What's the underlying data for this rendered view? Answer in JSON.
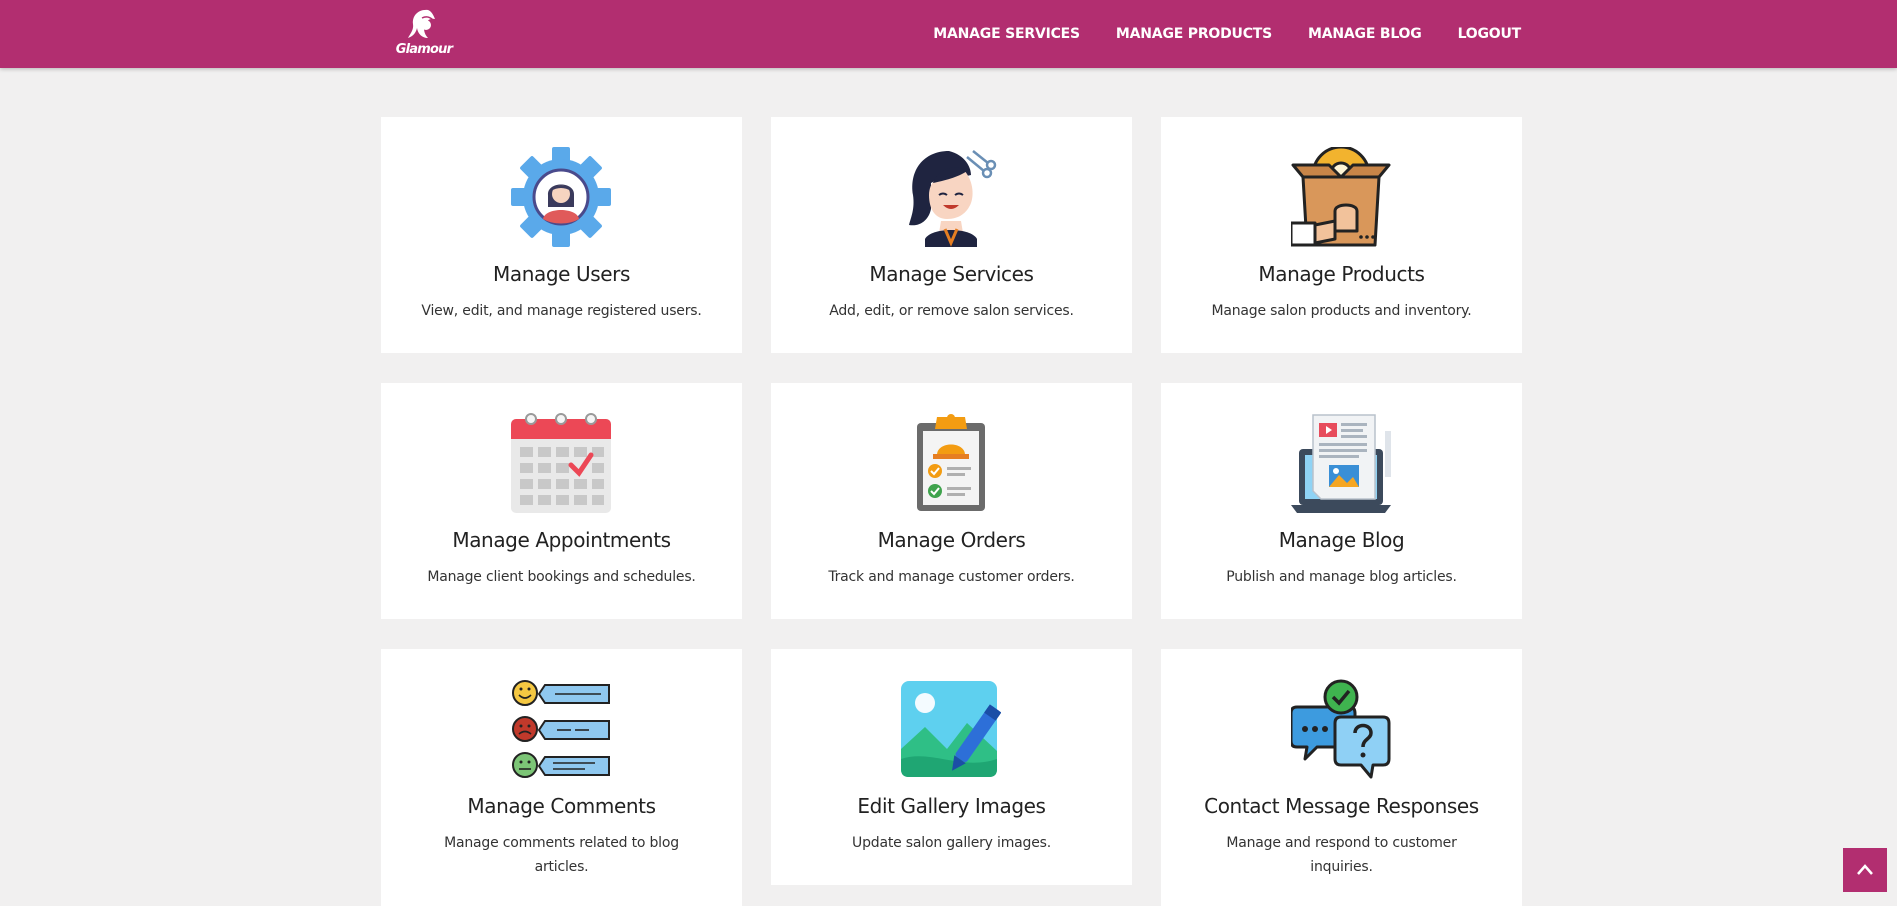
{
  "brand": {
    "logo_text": "Glamour",
    "primary_color": "#b22e70"
  },
  "nav": {
    "items": [
      {
        "label": "MANAGE SERVICES"
      },
      {
        "label": "MANAGE PRODUCTS"
      },
      {
        "label": "MANAGE BLOG"
      },
      {
        "label": "LOGOUT"
      }
    ]
  },
  "cards": [
    {
      "title": "Manage Users",
      "description": "View, edit, and manage registered users.",
      "icon": "user-gear-icon"
    },
    {
      "title": "Manage Services",
      "description": "Add, edit, or remove salon services.",
      "icon": "hair-salon-icon"
    },
    {
      "title": "Manage Products",
      "description": "Manage salon products and inventory.",
      "icon": "product-box-icon"
    },
    {
      "title": "Manage Appointments",
      "description": "Manage client bookings and schedules.",
      "icon": "calendar-icon"
    },
    {
      "title": "Manage Orders",
      "description": "Track and manage customer orders.",
      "icon": "clipboard-checklist-icon"
    },
    {
      "title": "Manage Blog",
      "description": "Publish and manage blog articles.",
      "icon": "laptop-blog-icon"
    },
    {
      "title": "Manage Comments",
      "description": "Manage comments related to blog articles.",
      "icon": "feedback-comments-icon"
    },
    {
      "title": "Edit Gallery Images",
      "description": "Update salon gallery images.",
      "icon": "image-edit-icon"
    },
    {
      "title": "Contact Message Responses",
      "description": "Manage and respond to customer inquiries.",
      "icon": "chat-bubbles-icon"
    }
  ],
  "scroll_top": {
    "icon": "chevron-up-icon"
  }
}
